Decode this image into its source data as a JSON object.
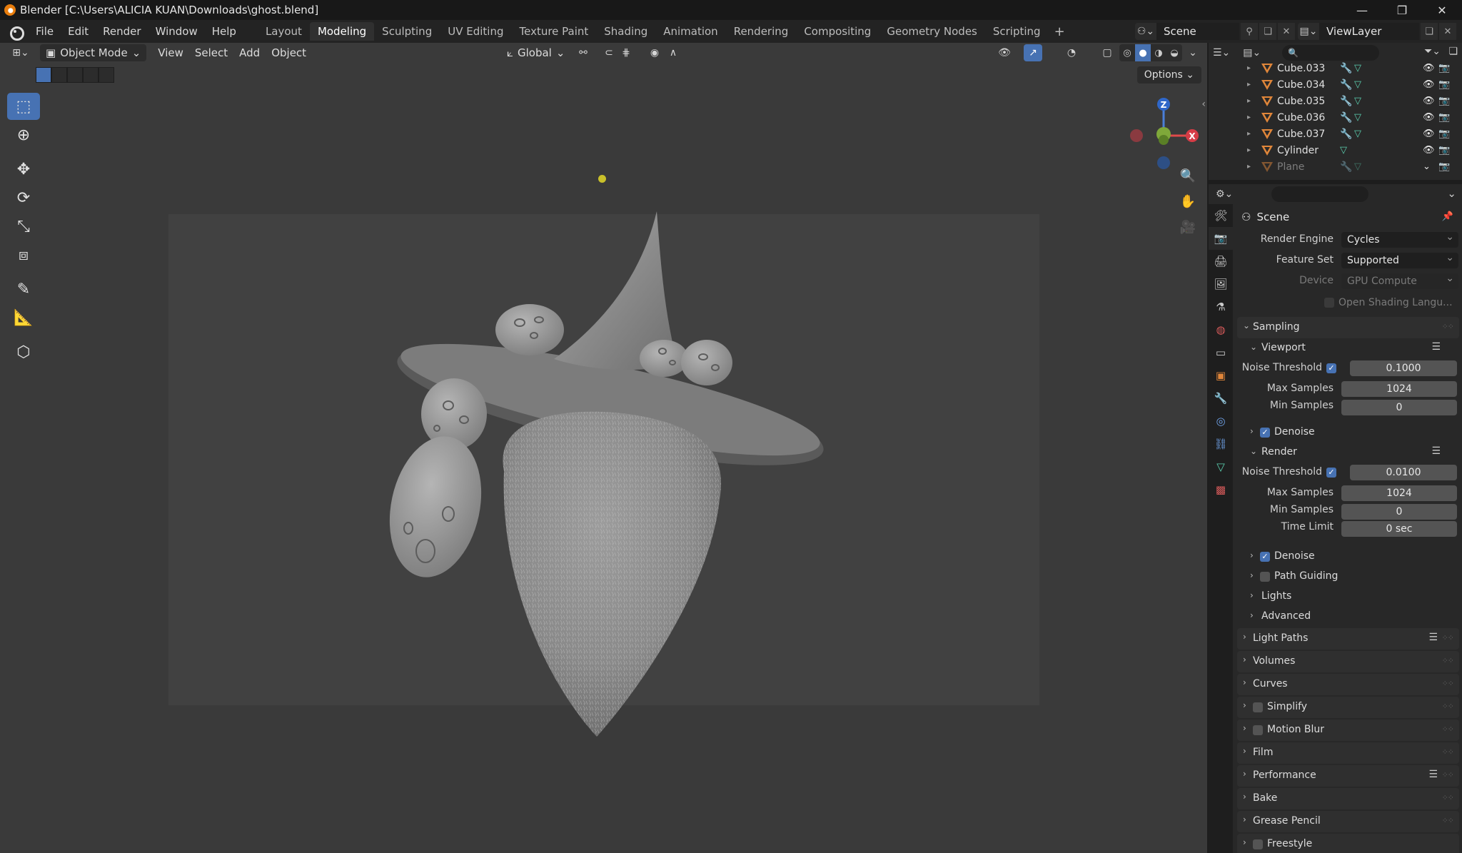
{
  "window": {
    "title": "Blender [C:\\Users\\ALICIA KUAN\\Downloads\\ghost.blend]",
    "controls": [
      "—",
      "❐",
      "✕"
    ]
  },
  "menus": [
    "File",
    "Edit",
    "Render",
    "Window",
    "Help"
  ],
  "workspaces": [
    "Layout",
    "Modeling",
    "Sculpting",
    "UV Editing",
    "Texture Paint",
    "Shading",
    "Animation",
    "Rendering",
    "Compositing",
    "Geometry Nodes",
    "Scripting"
  ],
  "active_workspace": "Modeling",
  "scene_name": "Scene",
  "view_layer": "ViewLayer",
  "viewport": {
    "mode": "Object Mode",
    "menus": [
      "View",
      "Select",
      "Add",
      "Object"
    ],
    "transform_orientation": "Global",
    "options_label": "Options",
    "gizmo_axes": {
      "z": "Z",
      "x": "X"
    }
  },
  "outliner": {
    "items": [
      {
        "name": "Cube.033",
        "modifier": true
      },
      {
        "name": "Cube.034",
        "modifier": true
      },
      {
        "name": "Cube.035",
        "modifier": true
      },
      {
        "name": "Cube.036",
        "modifier": true
      },
      {
        "name": "Cube.037",
        "modifier": true
      },
      {
        "name": "Cylinder",
        "modifier": false
      },
      {
        "name": "Plane",
        "modifier": true
      }
    ]
  },
  "properties": {
    "context": "Scene",
    "render_engine": {
      "label": "Render Engine",
      "value": "Cycles"
    },
    "feature_set": {
      "label": "Feature Set",
      "value": "Supported"
    },
    "device": {
      "label": "Device",
      "value": "GPU Compute"
    },
    "osl_label": "Open Shading Langu...",
    "sampling": {
      "title": "Sampling",
      "viewport": {
        "title": "Viewport",
        "noise_threshold_label": "Noise Threshold",
        "noise_threshold": "0.1000",
        "max_samples_label": "Max Samples",
        "max_samples": "1024",
        "min_samples_label": "Min Samples",
        "min_samples": "0",
        "denoise_label": "Denoise"
      },
      "render": {
        "title": "Render",
        "noise_threshold_label": "Noise Threshold",
        "noise_threshold": "0.0100",
        "max_samples_label": "Max Samples",
        "max_samples": "1024",
        "min_samples_label": "Min Samples",
        "min_samples": "0",
        "time_limit_label": "Time Limit",
        "time_limit": "0 sec",
        "denoise_label": "Denoise"
      },
      "path_guiding": "Path Guiding",
      "lights": "Lights",
      "advanced": "Advanced"
    },
    "panels": {
      "light_paths": "Light Paths",
      "volumes": "Volumes",
      "curves": "Curves",
      "simplify": "Simplify",
      "motion_blur": "Motion Blur",
      "film": "Film",
      "performance": "Performance",
      "bake": "Bake",
      "grease_pencil": "Grease Pencil",
      "freestyle": "Freestyle"
    }
  },
  "colors": {
    "accent": "#4772b3",
    "object_orange": "#e0863a",
    "modifier_blue": "#6fa2e8",
    "mesh_green": "#5bd0b0",
    "light_yellow": "#c9c02a"
  }
}
